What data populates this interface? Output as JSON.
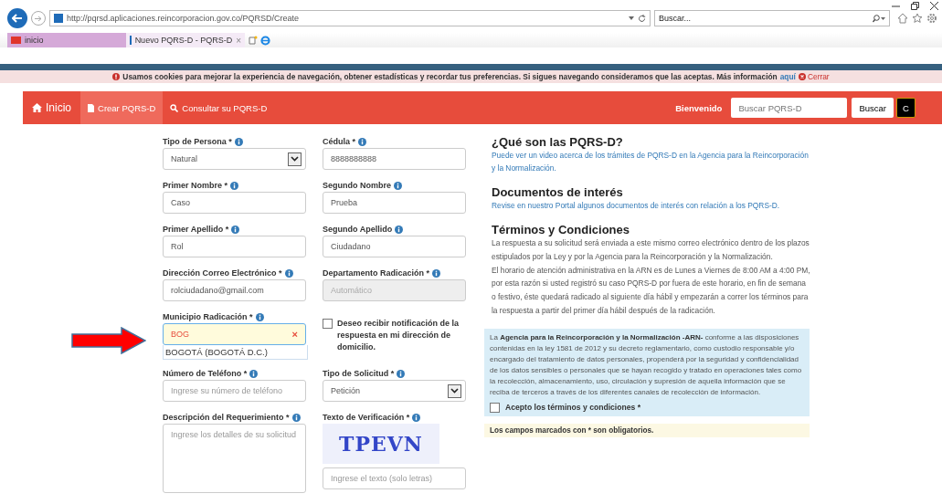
{
  "browser": {
    "url": "http://pqrsd.aplicaciones.reincorporacion.gov.co/PQRSD/Create",
    "search_placeholder": "Buscar...",
    "tabs": [
      {
        "label": "inicio",
        "selected": false
      },
      {
        "label": "Nuevo PQRS-D - PQRS-D",
        "selected": true,
        "close": "×"
      }
    ]
  },
  "cookie_bar": {
    "text": "Usamos cookies para mejorar la experiencia de navegación, obtener estadísticas y recordar tus preferencias. Si sigues navegando consideramos que las aceptas. Más información",
    "link": "aquí",
    "close": "Cerrar"
  },
  "navbar": {
    "items": [
      {
        "label": "Inicio",
        "kind": "home",
        "selected": false
      },
      {
        "label": "Crear PQRS-D",
        "kind": "file",
        "selected": true
      },
      {
        "label": "Consultar su PQRS-D",
        "kind": "search",
        "selected": false
      }
    ],
    "welcome": "Bienvenido",
    "search_placeholder": "Buscar PQRS-D",
    "search_button": "Buscar",
    "user_button": "C"
  },
  "form": {
    "fields": [
      {
        "kind": "select",
        "label": "Tipo de Persona *",
        "value": "Natural"
      },
      {
        "kind": "input",
        "label": "Cédula *",
        "value": "8888888888"
      },
      {
        "kind": "input",
        "label": "Primer Nombre *",
        "value": "Caso"
      },
      {
        "kind": "input",
        "label": "Segundo Nombre",
        "value": "Prueba"
      },
      {
        "kind": "input",
        "label": "Primer Apellido *",
        "value": "Rol"
      },
      {
        "kind": "input",
        "label": "Segundo Apellido",
        "value": "Ciudadano"
      },
      {
        "kind": "input",
        "label": "Dirección Correo Electrónico *",
        "value": "rolciudadano@gmail.com"
      },
      {
        "kind": "input",
        "label": "Departamento Radicación *",
        "value": "Automático",
        "disabled": true
      },
      {
        "kind": "autocomplete",
        "label": "Municipio Radicación *",
        "value": "BOG",
        "clear": "×",
        "suggestion": "BOGOTÁ (BOGOTÁ D.C.)"
      },
      {
        "kind": "checkbox",
        "label": "Deseo recibir notificación de la respuesta en mi dirección de domicilio.",
        "checked": false
      },
      {
        "kind": "input",
        "label": "Número de Teléfono *",
        "placeholder": "Ingrese su número de teléfono"
      },
      {
        "kind": "select",
        "label": "Tipo de Solicitud *",
        "value": "Petición"
      },
      {
        "kind": "textarea",
        "label": "Descripción del Requerimiento *",
        "placeholder": "Ingrese los detalles de su solicitud"
      },
      {
        "kind": "captcha",
        "label": "Texto de Verificación *",
        "captcha": "TPEVN",
        "placeholder": "Ingrese el texto (solo letras)"
      }
    ]
  },
  "info": {
    "sections": [
      {
        "title": "¿Qué son las PQRS-D?",
        "link": "Puede ver un video acerca de los trámites de PQRS-D en la Agencia para la Reincorporación y la Normalización."
      },
      {
        "title": "Documentos de interés",
        "link": "Revise en nuestro Portal algunos documentos de interés con relación a los PQRS-D."
      },
      {
        "title": "Términos y Condiciones",
        "paragraphs": [
          "La respuesta a su solicitud será enviada a este mismo correo electrónico dentro de los plazos estipulados por la Ley y por la Agencia para la Reincorporación y la Normalización.",
          "El horario de atención administrativa en la ARN es de Lunes a Viernes de 8:00 AM a 4:00 PM, por esta razón si usted registró su caso PQRS-D por fuera de este horario, en fin de semana o festivo, éste quedará radicado al siguiente día hábil y empezarán a correr los términos para la respuesta a partir del primer día hábil después de la radicación."
        ]
      }
    ],
    "privacy": "La **Agencia para la Reincorporación y la Normalización -ARN-** conforme a las disposiciones contenidas en la ley 1581 de 2012 y su decreto reglamentario, como custodio responsable y/o encargado del tratamiento de datos personales, propenderá por la seguridad y confidencialidad de los datos sensibles o personales que se hayan recogido y tratado en operaciones tales como la recolección, almacenamiento, uso, circulación y supresión de aquella información que se reciba de terceros a través de los diferentes canales de recolección de información.",
    "accept": {
      "label": "Acepto los términos y condiciones *",
      "checked": false
    },
    "required_note": "Los campos marcados con * son obligatorios."
  }
}
